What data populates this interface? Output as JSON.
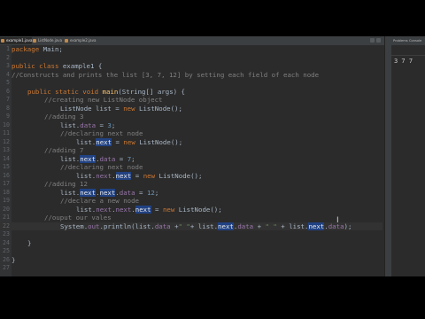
{
  "tabs": [
    {
      "label": "example1.java",
      "active": true
    },
    {
      "label": "ListNode.java",
      "active": false
    },
    {
      "label": "example2.java",
      "active": false
    }
  ],
  "panel": {
    "tabs": [
      "Problems",
      "Console"
    ],
    "output": "3 7 7"
  },
  "editor": {
    "line_numbers": [
      "1",
      "2",
      "3",
      "4",
      "5",
      "6",
      "7",
      "8",
      "9",
      "10",
      "11",
      "12",
      "13",
      "14",
      "15",
      "16",
      "17",
      "18",
      "19",
      "20",
      "21",
      "22",
      "23",
      "24",
      "25",
      "26",
      "27"
    ],
    "tokens": {
      "package": "package",
      "package_name": " Main;",
      "l3_kw": "public class",
      "l3_name": " example1 {",
      "l4_comment": "//Constructs and prints the list [3, 7, 12] by setting each field of each node",
      "l6_kw": "public static void",
      "l6_main": "main",
      "l6_rest": "(String[] args) {",
      "l7_comment": "//creating new ListNode object",
      "l8_a": "ListNode list = ",
      "l8_new": "new",
      "l8_b": " ListNode();",
      "l9_comment": "//adding 3",
      "l10_a": "list.",
      "l10_f": "data",
      "l10_b": " = ",
      "l10_n": "3",
      "l10_c": ";",
      "l11_comment": "//declaring next node",
      "l12_a": "list.",
      "l12_next": "next",
      "l12_b": " = ",
      "l12_new": "new",
      "l12_c": " ListNode();",
      "l13_comment": "//adding 7",
      "l14_a": "list.",
      "l14_next": "next",
      "l14_dot": ".",
      "l14_f": "data",
      "l14_b": " = ",
      "l14_n": "7",
      "l14_c": ";",
      "l15_comment": "//declaring next node",
      "l16_a": "list.",
      "l16_next1": "next",
      "l16_dot": ".",
      "l16_next2": "next",
      "l16_b": " = ",
      "l16_new": "new",
      "l16_c": " ListNode();",
      "l17_comment": "//adding 12",
      "l18_a": "list.",
      "l18_next1": "next",
      "l18_dot1": ".",
      "l18_next2": "next",
      "l18_dot2": ".",
      "l18_f": "data",
      "l18_b": " = ",
      "l18_n": "12",
      "l18_c": ";",
      "l19_comment": "//declare a new node",
      "l20_a": "list.",
      "l20_next1": "next",
      "l20_dot1": ".",
      "l20_next2": "next",
      "l20_dot2": ".",
      "l20_next3": "next",
      "l20_b": " = ",
      "l20_new": "new",
      "l20_c": " ListNode();",
      "l21_comment": "//ouput our vales",
      "l22_sys": "System.",
      "l22_out": "out",
      "l22_print": ".println(list.",
      "l22_f1": "data",
      "l22_plus1": " +",
      "l22_s1": "\" \"",
      "l22_plus2": "+ list.",
      "l22_next1": "next",
      "l22_dot1": ".",
      "l22_f2": "data",
      "l22_plus3": " + ",
      "l22_s2": "\" \"",
      "l22_plus4": " + list.",
      "l22_next2": "next",
      "l22_dot2": ".",
      "l22_f3": "data",
      "l22_end": ");",
      "brace": "}"
    }
  },
  "colors": {
    "background": "#2b2b2b",
    "keyword": "#cc7832",
    "comment": "#808080",
    "number": "#6897bb",
    "string": "#6a8759",
    "field": "#9876aa",
    "method": "#ffc66d",
    "selection": "#214283"
  },
  "icons": [
    "java-file-icon",
    "text-cursor-icon"
  ]
}
